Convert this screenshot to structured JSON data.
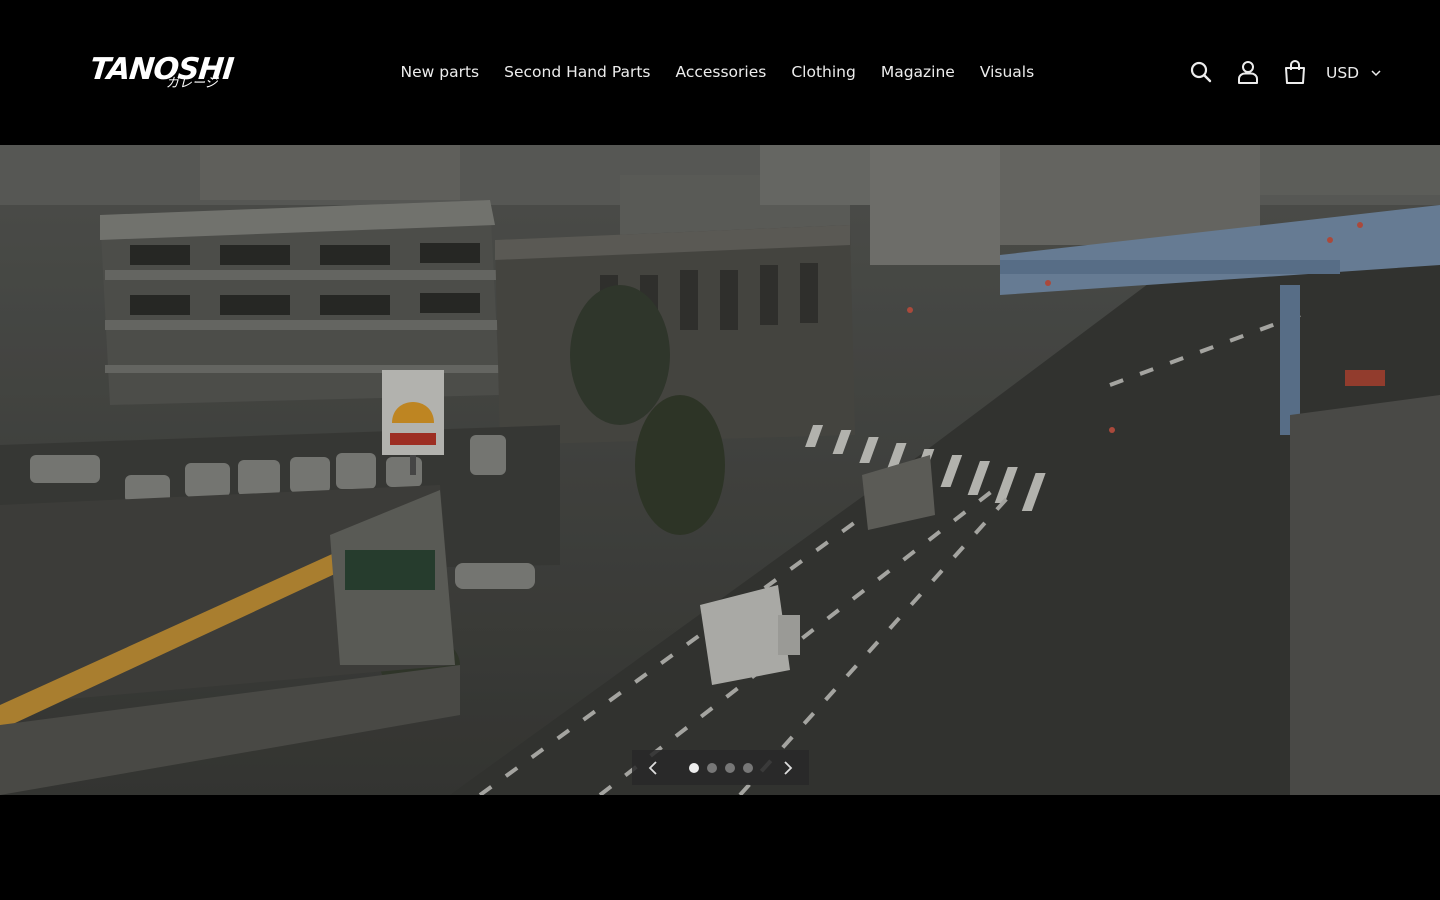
{
  "brand": {
    "logo_text": "TANOSHI",
    "logo_subtext": "ガレージ"
  },
  "nav": {
    "items": [
      {
        "label": "New parts"
      },
      {
        "label": "Second Hand Parts"
      },
      {
        "label": "Accessories"
      },
      {
        "label": "Clothing"
      },
      {
        "label": "Magazine"
      },
      {
        "label": "Visuals"
      }
    ]
  },
  "header_icons": {
    "search": "search-icon",
    "account": "user-icon",
    "cart": "cart-icon"
  },
  "currency": {
    "selected": "USD"
  },
  "slideshow": {
    "slide_count": 4,
    "active_index": 0,
    "prev_icon": "chevron-left-icon",
    "next_icon": "chevron-right-icon"
  },
  "colors": {
    "background": "#000000",
    "text": "#ececec",
    "dot_active": "#eeeeee",
    "dot_inactive": "#777777"
  }
}
